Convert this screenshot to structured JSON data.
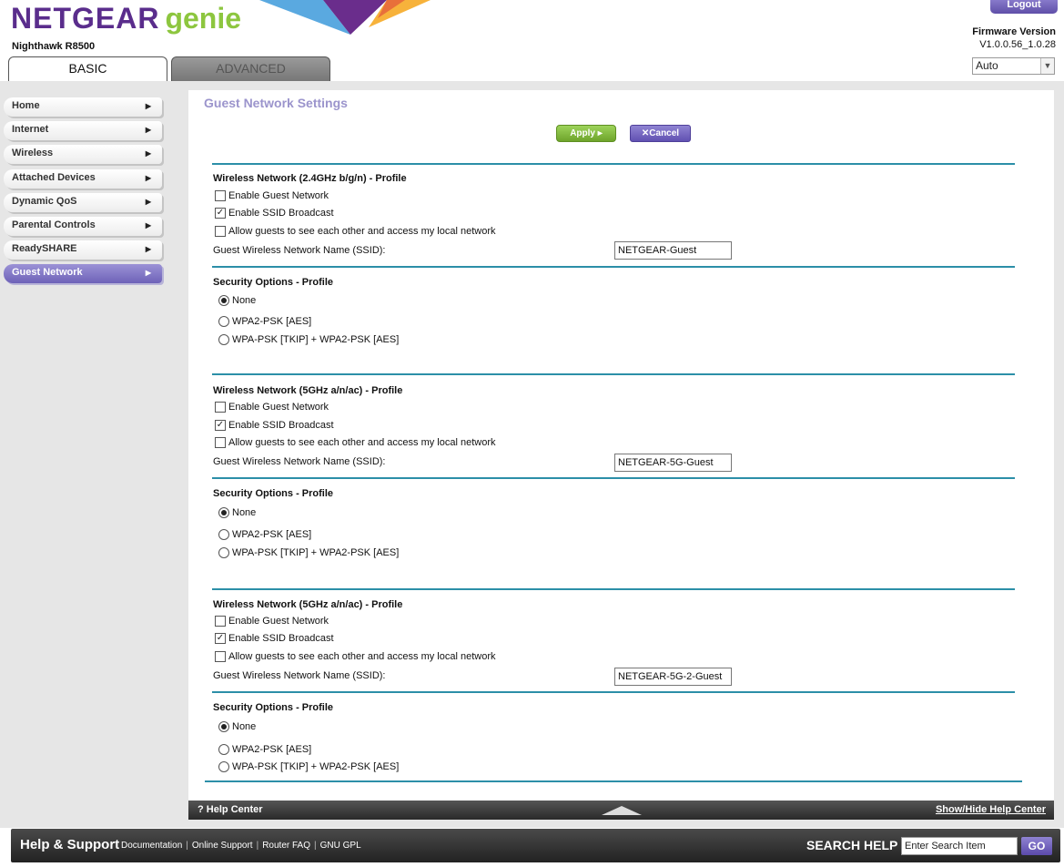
{
  "header": {
    "brand": "NETGEAR",
    "brand_sub": "genie",
    "model": "Nighthawk R8500",
    "logout_label": "Logout",
    "firmware_label": "Firmware Version",
    "firmware_value": "V1.0.0.56_1.0.28",
    "language_selected": "Auto"
  },
  "tabs": [
    {
      "label": "BASIC",
      "active": true
    },
    {
      "label": "ADVANCED",
      "active": false
    }
  ],
  "sidebar": {
    "items": [
      {
        "label": "Home"
      },
      {
        "label": "Internet"
      },
      {
        "label": "Wireless"
      },
      {
        "label": "Attached Devices"
      },
      {
        "label": "Dynamic QoS"
      },
      {
        "label": "Parental Controls"
      },
      {
        "label": "ReadySHARE"
      },
      {
        "label": "Guest Network",
        "active": true
      }
    ]
  },
  "main": {
    "title": "Guest Network Settings",
    "apply_label": "Apply ▸",
    "cancel_label": "✕Cancel",
    "profiles": [
      {
        "title": "Wireless Network (2.4GHz b/g/n) - Profile",
        "enable_guest": {
          "label": "Enable Guest Network",
          "checked": false
        },
        "ssid_broadcast": {
          "label": "Enable SSID Broadcast",
          "checked": true
        },
        "allow_local": {
          "label": "Allow guests to see each other and access my local network",
          "checked": false
        },
        "ssid_label": "Guest Wireless Network Name (SSID):",
        "ssid_value": "NETGEAR-Guest",
        "security_title": "Security Options - Profile",
        "security_options": [
          {
            "label": "None",
            "selected": true
          },
          {
            "label": "WPA2-PSK [AES]",
            "selected": false
          },
          {
            "label": "WPA-PSK [TKIP] + WPA2-PSK [AES]",
            "selected": false
          }
        ]
      },
      {
        "title": "Wireless Network (5GHz a/n/ac) - Profile",
        "enable_guest": {
          "label": "Enable Guest Network",
          "checked": false
        },
        "ssid_broadcast": {
          "label": "Enable SSID Broadcast",
          "checked": true
        },
        "allow_local": {
          "label": "Allow guests to see each other and access my local network",
          "checked": false
        },
        "ssid_label": "Guest Wireless Network Name (SSID):",
        "ssid_value": "NETGEAR-5G-Guest",
        "security_title": "Security Options - Profile",
        "security_options": [
          {
            "label": "None",
            "selected": true
          },
          {
            "label": "WPA2-PSK [AES]",
            "selected": false
          },
          {
            "label": "WPA-PSK [TKIP] + WPA2-PSK [AES]",
            "selected": false
          }
        ]
      },
      {
        "title": "Wireless Network (5GHz a/n/ac) - Profile",
        "enable_guest": {
          "label": "Enable Guest Network",
          "checked": false
        },
        "ssid_broadcast": {
          "label": "Enable SSID Broadcast",
          "checked": true
        },
        "allow_local": {
          "label": "Allow guests to see each other and access my local network",
          "checked": false
        },
        "ssid_label": "Guest Wireless Network Name (SSID):",
        "ssid_value": "NETGEAR-5G-2-Guest",
        "security_title": "Security Options - Profile",
        "security_options": [
          {
            "label": "None",
            "selected": true
          },
          {
            "label": "WPA2-PSK [AES]",
            "selected": false
          },
          {
            "label": "WPA-PSK [TKIP] + WPA2-PSK [AES]",
            "selected": false
          }
        ]
      }
    ]
  },
  "helpbar": {
    "help_center": "Help Center",
    "toggle_label": "Show/Hide Help Center"
  },
  "footer": {
    "title": "Help & Support",
    "links": [
      "Documentation",
      "Online Support",
      "Router FAQ",
      "GNU GPL"
    ],
    "search_label": "SEARCH HELP",
    "search_placeholder": "Enter Search Item",
    "go_label": "GO"
  },
  "colors": {
    "accent_purple": "#6e62b8",
    "accent_green": "#8dc63f",
    "section_line": "#2c8fa8"
  }
}
